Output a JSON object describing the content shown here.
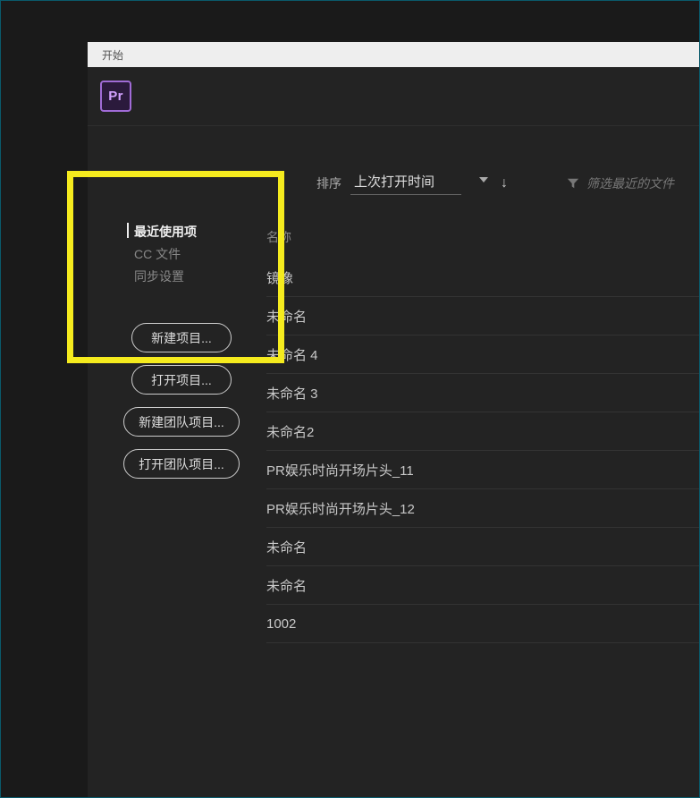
{
  "window": {
    "title": "开始"
  },
  "logo": {
    "text": "Pr"
  },
  "sort": {
    "label": "排序",
    "selected": "上次打开时间"
  },
  "filter": {
    "placeholder": "筛选最近的文件"
  },
  "sidebar": {
    "items": [
      {
        "label": "最近使用项",
        "active": true
      },
      {
        "label": "CC 文件",
        "active": false
      },
      {
        "label": "同步设置",
        "active": false
      }
    ],
    "buttons": [
      {
        "label": "新建项目..."
      },
      {
        "label": "打开项目..."
      },
      {
        "label": "新建团队项目..."
      },
      {
        "label": "打开团队项目..."
      }
    ]
  },
  "table": {
    "header": "名称",
    "rows": [
      {
        "name": "镜像"
      },
      {
        "name": "未命名"
      },
      {
        "name": "未命名 4"
      },
      {
        "name": "未命名 3"
      },
      {
        "name": "未命名2"
      },
      {
        "name": "PR娱乐时尚开场片头_11"
      },
      {
        "name": "PR娱乐时尚开场片头_12"
      },
      {
        "name": "未命名"
      },
      {
        "name": "未命名"
      },
      {
        "name": "1002"
      }
    ]
  }
}
